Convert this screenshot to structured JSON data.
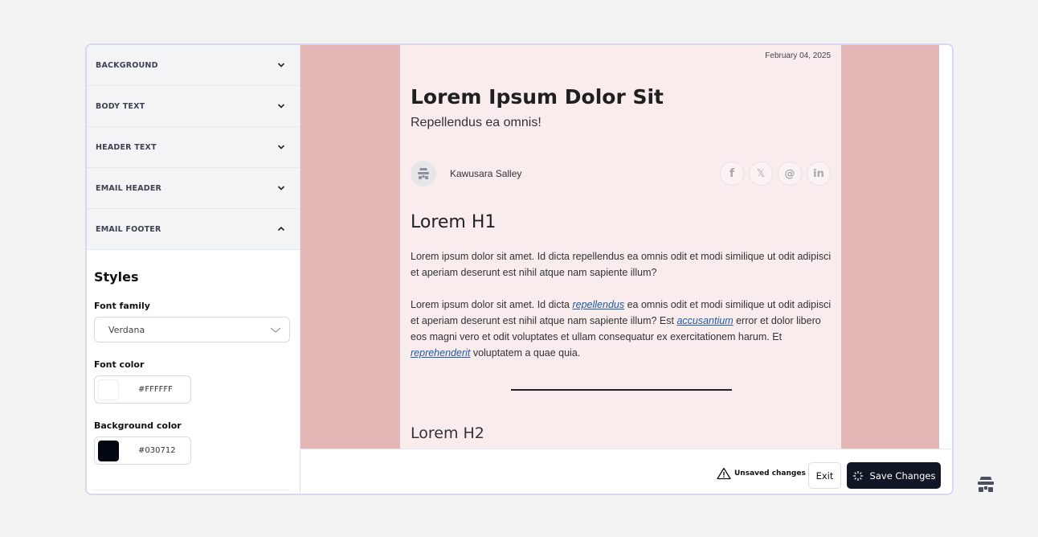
{
  "sidebar": {
    "sections": [
      {
        "label": "BACKGROUND",
        "expanded": false
      },
      {
        "label": "BODY TEXT",
        "expanded": false
      },
      {
        "label": "HEADER TEXT",
        "expanded": false
      },
      {
        "label": "EMAIL HEADER",
        "expanded": false
      },
      {
        "label": "EMAIL FOOTER",
        "expanded": true
      }
    ],
    "styles": {
      "title": "Styles",
      "font_family_label": "Font family",
      "font_family_value": "Verdana",
      "font_color_label": "Font color",
      "font_color_value": "#FFFFFF",
      "background_color_label": "Background color",
      "background_color_value": "#030712"
    }
  },
  "email": {
    "date": "February 04, 2025",
    "title": "Lorem Ipsum Dolor Sit",
    "subtitle": "Repellendus ea omnis!",
    "author": "Kawusara Salley",
    "socials": [
      "facebook-icon",
      "x-icon",
      "threads-icon",
      "linkedin-icon"
    ],
    "h1": "Lorem H1",
    "para1": "Lorem ipsum dolor sit amet. Id dicta repellendus ea omnis odit et modi similique ut odit adipisci et aperiam deserunt est nihil atque nam sapiente illum?",
    "para2": {
      "t1": "Lorem ipsum dolor sit amet. Id dicta ",
      "link1": "repellendus",
      "t2": " ea omnis odit et modi similique ut odit adipisci et aperiam deserunt est nihil atque nam sapiente illum? Est ",
      "link2": "accusantium",
      "t3": " error et dolor libero eos magni vero et odit voluptates et ullam consequatur ex exercitationem harum. Et ",
      "link3": "reprehenderit",
      "t4": " voluptatem a quae quia."
    },
    "h2": "Lorem H2"
  },
  "footer": {
    "unsaved_label": "Unsaved changes",
    "exit_label": "Exit",
    "save_label": "Save Changes"
  },
  "colors": {
    "outer_background": "#e5b6b6",
    "email_background": "#f9ecec",
    "save_button": "#111624",
    "link": "#1e5aa6"
  }
}
